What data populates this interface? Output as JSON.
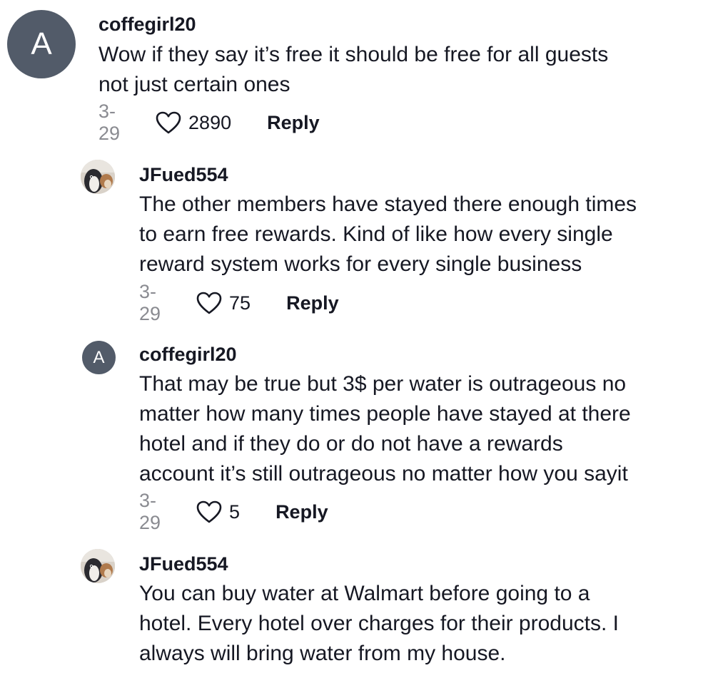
{
  "colors": {
    "text": "#161823",
    "meta_gray": "#8a8b91",
    "avatar_letter_bg": "#525b69"
  },
  "comments": [
    {
      "username": "coffegirl20",
      "avatar_letter": "A",
      "lines": [
        "Wow if they say it’s free it should be free for all guests",
        "not just certain ones"
      ],
      "date": "3-29",
      "likes": "2890",
      "reply_label": "Reply"
    },
    {
      "username": "JFued554",
      "avatar_icon": "penguin-photo-icon",
      "lines": [
        "The other members have stayed there enough times",
        "to earn free rewards. Kind of like how every single",
        "reward system works for every single business"
      ],
      "date": "3-29",
      "likes": "75",
      "reply_label": "Reply"
    },
    {
      "username": "coffegirl20",
      "avatar_letter": "A",
      "lines": [
        "That may be true but 3$ per water is outrageous no",
        "matter how many times people have stayed at there",
        "hotel and if they do or do not have a rewards",
        "account it’s still outrageous no matter how you sayit"
      ],
      "date": "3-29",
      "likes": "5",
      "reply_label": "Reply"
    },
    {
      "username": "JFued554",
      "avatar_icon": "penguin-photo-icon",
      "lines": [
        "You can buy water at Walmart before going to a",
        "hotel. Every hotel over charges for their products. I",
        "always will bring water from my house."
      ]
    }
  ]
}
